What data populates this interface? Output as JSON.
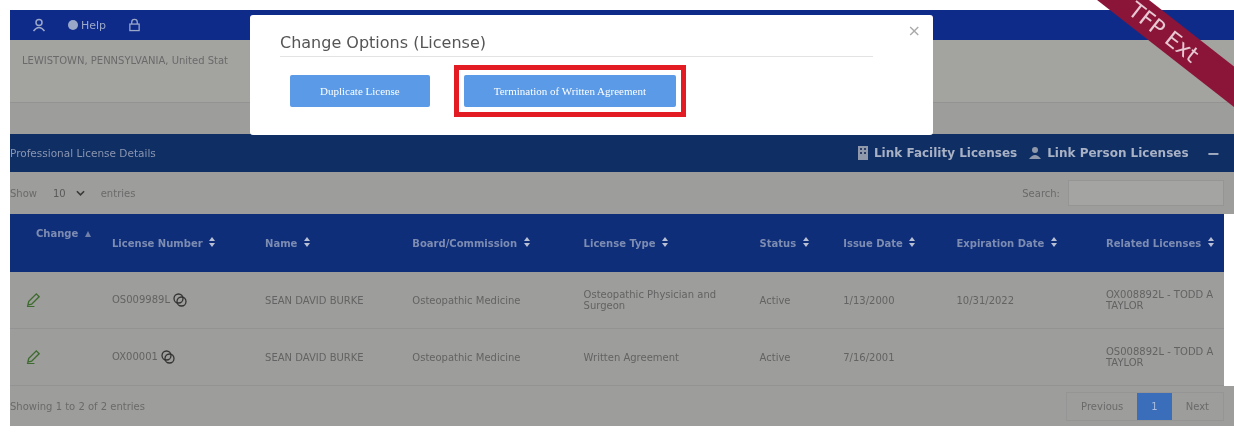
{
  "top_bar": {
    "help_label": "Help"
  },
  "address": {
    "line": "LEWISTOWN, PENNSYLVANIA, United Stat"
  },
  "ribbon": {
    "text": "TFP Ext"
  },
  "panel": {
    "title": "Professional License Details",
    "actions": [
      {
        "label": "Link Facility Licenses",
        "kind": "building"
      },
      {
        "label": "Link Person Licenses",
        "kind": "person"
      }
    ],
    "collapse": "−"
  },
  "length_menu": {
    "before": "Show",
    "value": "10",
    "after": "entries"
  },
  "search": {
    "label": "Search:"
  },
  "table": {
    "columns": [
      {
        "label": "Change",
        "sorted": true
      },
      {
        "label": "License Number",
        "sorted": false
      },
      {
        "label": "Name",
        "sorted": false
      },
      {
        "label": "Board/Commission",
        "sorted": false
      },
      {
        "label": "License Type",
        "sorted": false
      },
      {
        "label": "Status",
        "sorted": false
      },
      {
        "label": "Issue Date",
        "sorted": false
      },
      {
        "label": "Expiration Date",
        "sorted": false
      },
      {
        "label": "Related Licenses",
        "sorted": false
      }
    ],
    "rows": [
      {
        "license_number": "OS009989L",
        "name": "SEAN DAVID BURKE",
        "board": "Osteopathic Medicine",
        "license_type": "Osteopathic Physician and Surgeon",
        "status": "Active",
        "issue_date": "1/13/2000",
        "expiration_date": "10/31/2022",
        "related": "OX008892L - TODD A TAYLOR"
      },
      {
        "license_number": "OX00001",
        "name": "SEAN DAVID BURKE",
        "board": "Osteopathic Medicine",
        "license_type": "Written Agreement",
        "status": "Active",
        "issue_date": "7/16/2001",
        "related": "OS008892L - TODD A TAYLOR"
      }
    ]
  },
  "footer": {
    "info": "Showing 1 to 2 of 2 entries",
    "pages": [
      {
        "label": "Previous",
        "selected": false
      },
      {
        "label": "1",
        "selected": true
      },
      {
        "label": "Next",
        "selected": false
      }
    ]
  },
  "modal": {
    "title": "Change Options (License)",
    "close": "×",
    "buttons": [
      {
        "label": "Duplicate License",
        "highlighted": false
      },
      {
        "label": "Termination of Written Agreement",
        "highlighted": true
      }
    ]
  }
}
